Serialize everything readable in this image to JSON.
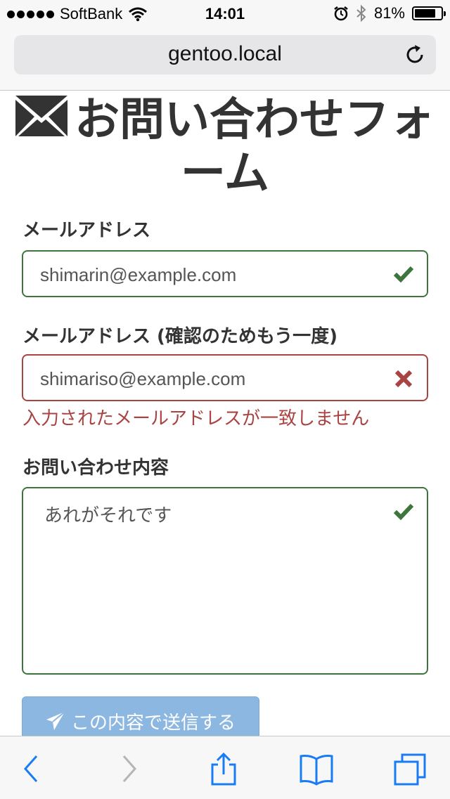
{
  "status_bar": {
    "carrier": "SoftBank",
    "time": "14:01",
    "battery": "81%",
    "battery_level": 0.81
  },
  "browser": {
    "url": "gentoo.local"
  },
  "form": {
    "title": "お問い合わせフォーム",
    "title_icon": "envelope-icon",
    "email_label": "メールアドレス",
    "email_value": "shimarin@example.com",
    "email_confirm_label": "メールアドレス (確認のためもう一度)",
    "email_confirm_value": "shimariso@example.com",
    "email_confirm_error": "入力されたメールアドレスが一致しません",
    "message_label": "お問い合わせ内容",
    "message_value": "あれがそれです",
    "submit_label": "この内容で送信する",
    "colors": {
      "valid": "#3c763d",
      "error": "#a94442",
      "button": "#8cb7e0"
    }
  },
  "toolbar": {
    "icons": [
      "back-icon",
      "forward-icon",
      "share-icon",
      "bookmarks-icon",
      "tabs-icon"
    ]
  }
}
